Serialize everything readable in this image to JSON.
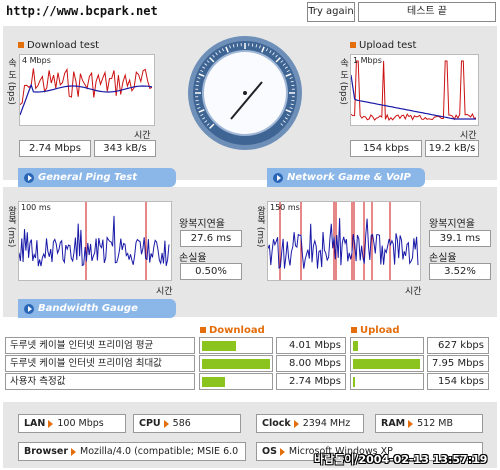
{
  "header": {
    "url": "http://www.bcpark.net",
    "try_again": "Try again",
    "status": "테스트 끝"
  },
  "download": {
    "title": "Download test",
    "ylabel": "속 도 (bps)",
    "scale": "4 Mbps",
    "xlabel": "시간",
    "mbps": "2.74 Mbps",
    "kbs": "343 kB/s"
  },
  "upload": {
    "title": "Upload test",
    "ylabel": "속 도 (bps)",
    "scale": "1 Mbps",
    "xlabel": "시간",
    "kbps": "154 kbps",
    "kbs": "19.2 kB/s"
  },
  "tabs": {
    "ping": "General Ping Test",
    "voip": "Network Game & VoIP Test",
    "bandwidth": "Bandwidth Gauge"
  },
  "ping": {
    "ylabel": "왕복 (ms)",
    "scale": "100 ms",
    "xlabel": "시간",
    "latency_label": "왕복지연율",
    "latency": "27.6 ms",
    "loss_label": "손실율",
    "loss": "0.50%"
  },
  "voip": {
    "ylabel": "왕복 (ms)",
    "scale": "150 ms",
    "xlabel": "시간",
    "latency_label": "왕복지연율",
    "latency": "39.1 ms",
    "loss_label": "손실율",
    "loss": "3.52%"
  },
  "bandwidth": {
    "download_header": "Download",
    "upload_header": "Upload",
    "rows": [
      {
        "label": "두루넷 케이블 인터넷 프리미엄 평균",
        "down": "4.01 Mbps",
        "down_frac": 0.5,
        "up": "627 kbps",
        "up_frac": 0.08
      },
      {
        "label": "두루넷 케이블 인터넷 프리미엄 최대값",
        "down": "8.00 Mbps",
        "down_frac": 1.0,
        "up": "7.95 Mbps",
        "up_frac": 0.99
      },
      {
        "label": "사용자 측정값",
        "down": "2.74 Mbps",
        "down_frac": 0.34,
        "up": "154 kbps",
        "up_frac": 0.02
      }
    ]
  },
  "system": {
    "lan_label": "LAN",
    "lan": "100 Mbps",
    "cpu_label": "CPU",
    "cpu": "586",
    "clock_label": "Clock",
    "clock": "2394 MHz",
    "ram_label": "RAM",
    "ram": "512 MB",
    "browser_label": "Browser",
    "browser": "Mozilla/4.0 (compatible; MSIE 6.0",
    "os_label": "OS",
    "os": "Microsoft Windows XP"
  },
  "watermark": "바람돌이/2004-02-13 13:57:19",
  "colors": {
    "accent": "#e46d0c",
    "tab": "#8ab6e8",
    "bar": "#8cc41f",
    "series_red": "#cc1111",
    "series_blue": "#1a1aa8"
  }
}
